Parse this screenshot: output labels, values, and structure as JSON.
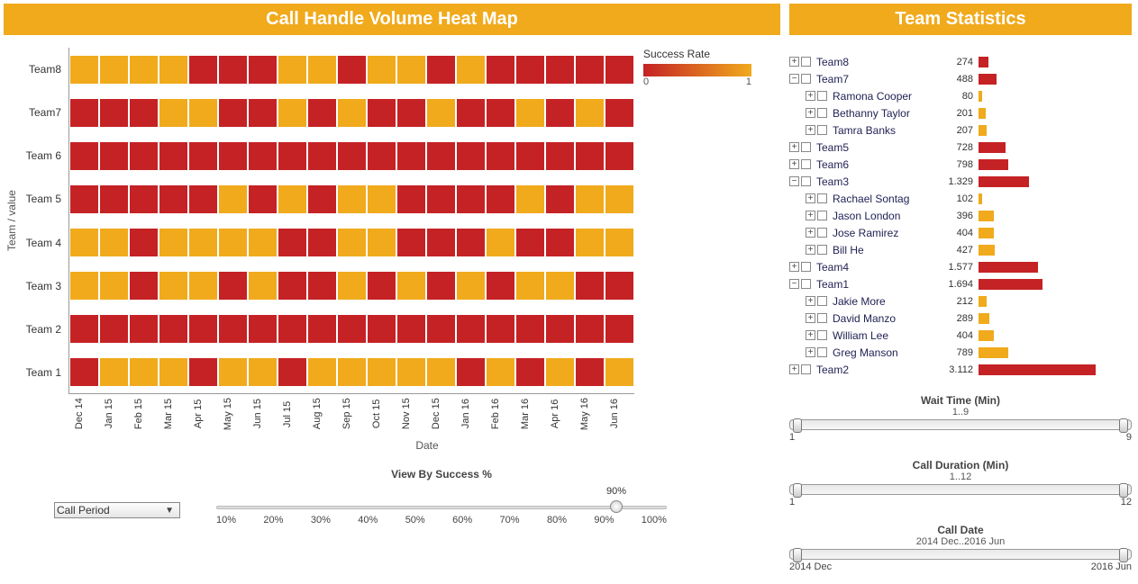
{
  "left": {
    "title": "Call Handle Volume Heat Map",
    "yaxis": "Team / value",
    "xaxis": "Date",
    "legend_title": "Success Rate",
    "legend_min": "0",
    "legend_max": "1",
    "dropdown": "Call Period",
    "slider_title": "View By Success %",
    "slider_value": "90%",
    "slider_ticks": [
      "10%",
      "20%",
      "30%",
      "40%",
      "50%",
      "60%",
      "70%",
      "80%",
      "90%",
      "100%"
    ]
  },
  "right": {
    "title": "Team Statistics",
    "slider1": {
      "title": "Wait Time (Min)",
      "range": "1..9",
      "min": "1",
      "max": "9"
    },
    "slider2": {
      "title": "Call Duration (Min)",
      "range": "1..12",
      "min": "1",
      "max": "12"
    },
    "slider3": {
      "title": "Call Date",
      "range": "2014 Dec..2016 Jun",
      "min": "2014 Dec",
      "max": "2016 Jun"
    }
  },
  "chart_data": {
    "heatmap": {
      "type": "heatmap",
      "title": "Call Handle Volume Heat Map",
      "ylabel": "Team / value",
      "xlabel": "Date",
      "legend": "Success Rate",
      "color_scale": {
        "0": "#c52225",
        "1": "#f0aa1c"
      },
      "y_categories": [
        "Team8",
        "Team7",
        "Team 6",
        "Team 5",
        "Team 4",
        "Team 3",
        "Team 2",
        "Team 1"
      ],
      "x_categories": [
        "Dec 14",
        "Jan 15",
        "Feb 15",
        "Mar 15",
        "Apr 15",
        "May 15",
        "Jun 15",
        "Jul 15",
        "Aug 15",
        "Sep 15",
        "Oct 15",
        "Nov 15",
        "Dec 15",
        "Jan 16",
        "Feb 16",
        "Mar 16",
        "Apr 16",
        "May 16",
        "Jun 16"
      ],
      "values": [
        [
          1,
          1,
          1,
          1,
          0,
          0,
          0,
          1,
          1,
          0,
          1,
          1,
          0,
          1,
          0,
          0,
          0,
          0,
          0
        ],
        [
          0,
          0,
          0,
          1,
          1,
          0,
          0,
          1,
          0,
          1,
          0,
          0,
          1,
          0,
          0,
          1,
          0,
          1,
          0
        ],
        [
          0,
          0,
          0,
          0,
          0,
          0,
          0,
          0,
          0,
          0,
          0,
          0,
          0,
          0,
          0,
          0,
          0,
          0,
          0
        ],
        [
          0,
          0,
          0,
          0,
          0,
          1,
          0,
          1,
          0,
          1,
          1,
          0,
          0,
          0,
          0,
          1,
          0,
          1,
          1
        ],
        [
          1,
          1,
          0,
          1,
          1,
          1,
          1,
          0,
          0,
          1,
          1,
          0,
          0,
          0,
          1,
          0,
          0,
          1,
          1
        ],
        [
          1,
          1,
          0,
          1,
          1,
          0,
          1,
          0,
          0,
          1,
          0,
          1,
          0,
          1,
          0,
          1,
          1,
          0,
          0
        ],
        [
          0,
          0,
          0,
          0,
          0,
          0,
          0,
          0,
          0,
          0,
          0,
          0,
          0,
          0,
          0,
          0,
          0,
          0,
          0
        ],
        [
          0,
          1,
          1,
          1,
          0,
          1,
          1,
          0,
          1,
          1,
          1,
          1,
          1,
          0,
          1,
          0,
          1,
          0,
          1
        ]
      ]
    },
    "tree": {
      "type": "bar",
      "title": "Team Statistics",
      "max": 3112,
      "rows": [
        {
          "label": "Team8",
          "value": 274,
          "level": 0,
          "color": "red",
          "state": "plus"
        },
        {
          "label": "Team7",
          "value": 488,
          "level": 0,
          "color": "red",
          "state": "minus"
        },
        {
          "label": "Ramona Cooper",
          "value": 80,
          "level": 1,
          "color": "amber",
          "state": "plus"
        },
        {
          "label": "Bethanny Taylor",
          "value": 201,
          "level": 1,
          "color": "amber",
          "state": "plus"
        },
        {
          "label": "Tamra Banks",
          "value": 207,
          "level": 1,
          "color": "amber",
          "state": "plus"
        },
        {
          "label": "Team5",
          "value": 728,
          "level": 0,
          "color": "red",
          "state": "plus"
        },
        {
          "label": "Team6",
          "value": 798,
          "level": 0,
          "color": "red",
          "state": "plus"
        },
        {
          "label": "Team3",
          "value": 1329,
          "level": 0,
          "color": "red",
          "state": "minus",
          "display": "1.329"
        },
        {
          "label": "Rachael Sontag",
          "value": 102,
          "level": 1,
          "color": "amber",
          "state": "plus"
        },
        {
          "label": "Jason London",
          "value": 396,
          "level": 1,
          "color": "amber",
          "state": "plus"
        },
        {
          "label": "Jose Ramirez",
          "value": 404,
          "level": 1,
          "color": "amber",
          "state": "plus"
        },
        {
          "label": "Bill He",
          "value": 427,
          "level": 1,
          "color": "amber",
          "state": "plus"
        },
        {
          "label": "Team4",
          "value": 1577,
          "level": 0,
          "color": "red",
          "state": "plus",
          "display": "1.577"
        },
        {
          "label": "Team1",
          "value": 1694,
          "level": 0,
          "color": "red",
          "state": "minus",
          "display": "1.694"
        },
        {
          "label": "Jakie More",
          "value": 212,
          "level": 1,
          "color": "amber",
          "state": "plus"
        },
        {
          "label": "David Manzo",
          "value": 289,
          "level": 1,
          "color": "amber",
          "state": "plus"
        },
        {
          "label": "William Lee",
          "value": 404,
          "level": 1,
          "color": "amber",
          "state": "plus"
        },
        {
          "label": "Greg Manson",
          "value": 789,
          "level": 1,
          "color": "amber",
          "state": "plus"
        },
        {
          "label": "Team2",
          "value": 3112,
          "level": 0,
          "color": "red",
          "state": "plus",
          "display": "3.112"
        }
      ]
    }
  }
}
